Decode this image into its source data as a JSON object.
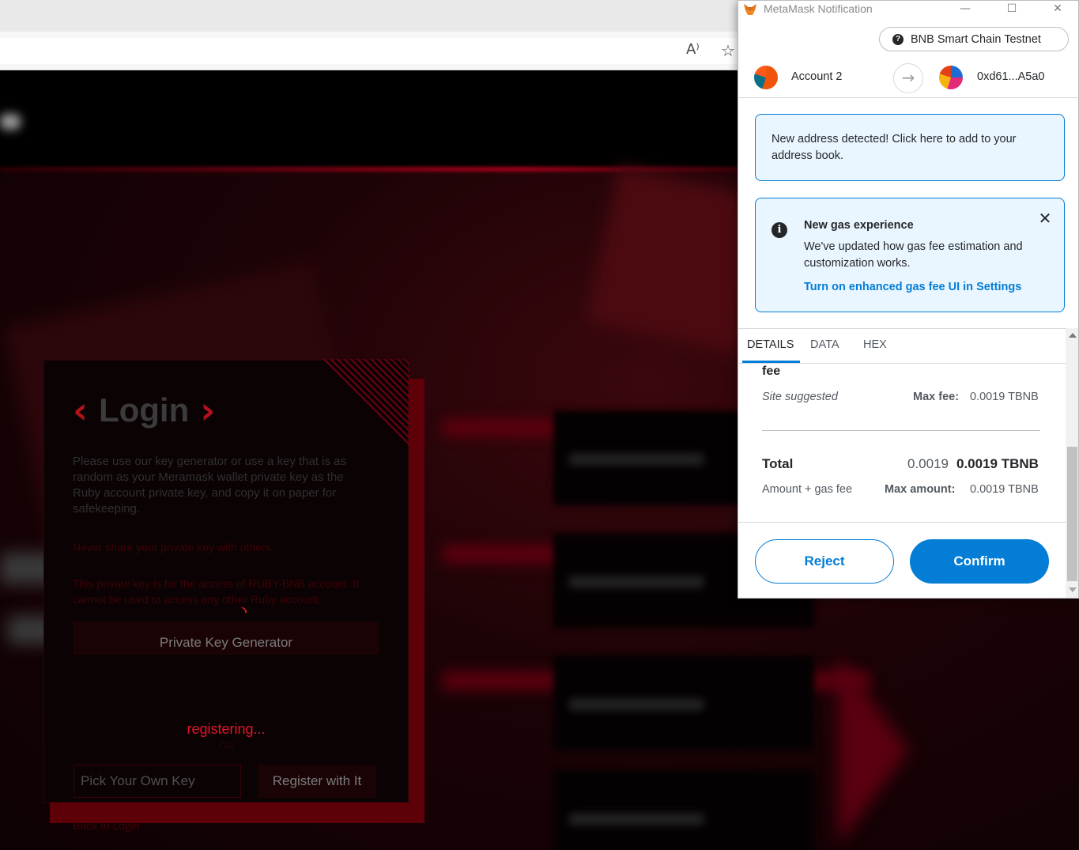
{
  "metamask": {
    "window_title": "MetaMask Notification",
    "network": "BNB Smart Chain Testnet",
    "from_account": "Account 2",
    "to_address": "0xd61...A5a0",
    "notices": {
      "address_detected": "New address detected! Click here to add to your address book.",
      "gas_title": "New gas experience",
      "gas_body": "We've updated how gas fee estimation and customization works.",
      "gas_link": "Turn on enhanced gas fee UI in Settings"
    },
    "tabs": [
      "DETAILS",
      "DATA",
      "HEX"
    ],
    "details": {
      "fee_label": "fee",
      "site_suggested": "Site suggested",
      "max_fee_label": "Max fee:",
      "max_fee_value": "0.0019 TBNB",
      "total_label": "Total",
      "total_value_plain": "0.0019",
      "total_value_bold": "0.0019 TBNB",
      "amount_gas_label": "Amount + gas fee",
      "max_amount_label": "Max amount:",
      "max_amount_value": "0.0019 TBNB"
    },
    "buttons": {
      "reject": "Reject",
      "confirm": "Confirm"
    },
    "colors": {
      "accent": "#037dd6",
      "notice_bg": "#eaf6ff"
    }
  },
  "site": {
    "login_title": "Login",
    "description": "Please use our key generator or use a key that is as random as your Meramask wallet private key as the Ruby account private key, and copy it on paper for safekeeping.",
    "warning_1": "Never share your private key with others.",
    "warning_2": "This private key is for the access of RUBY-BNB account. It cannot be used to access any other Ruby account.",
    "keygen_button": "Private Key Generator",
    "status": "registering...",
    "or_text": "OR",
    "pick_key_placeholder": "Pick Your Own Key",
    "register_button": "Register with It",
    "back_link": "Back to Login",
    "colors": {
      "accent": "#e3142a"
    }
  },
  "icons": {
    "read_aloud": "A⁾",
    "favorites": "☆",
    "arrow": "→",
    "help": "?",
    "info": "i",
    "close": "✕",
    "win_min": "—",
    "win_max": "☐",
    "win_close": "✕",
    "chevron_left": "‹",
    "chevron_right": "›"
  }
}
